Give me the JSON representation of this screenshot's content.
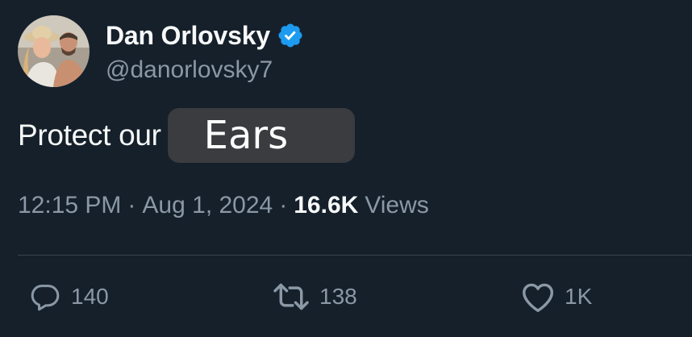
{
  "user": {
    "display_name": "Dan Orlovsky",
    "handle": "@danorlovsky7",
    "verified": true
  },
  "tweet": {
    "text": "Protect our",
    "overlay_text": "Ears",
    "time": "12:15 PM",
    "separator": "·",
    "date": "Aug 1, 2024",
    "views_count": "16.6K",
    "views_label": "Views"
  },
  "actions": {
    "replies": "140",
    "retweets": "138",
    "likes": "1K"
  },
  "colors": {
    "background": "#15202b",
    "verified_badge": "#1d9bf0",
    "secondary_text": "#8b98a5"
  },
  "icons": [
    "verified-badge-icon",
    "reply-icon",
    "retweet-icon",
    "like-icon"
  ]
}
